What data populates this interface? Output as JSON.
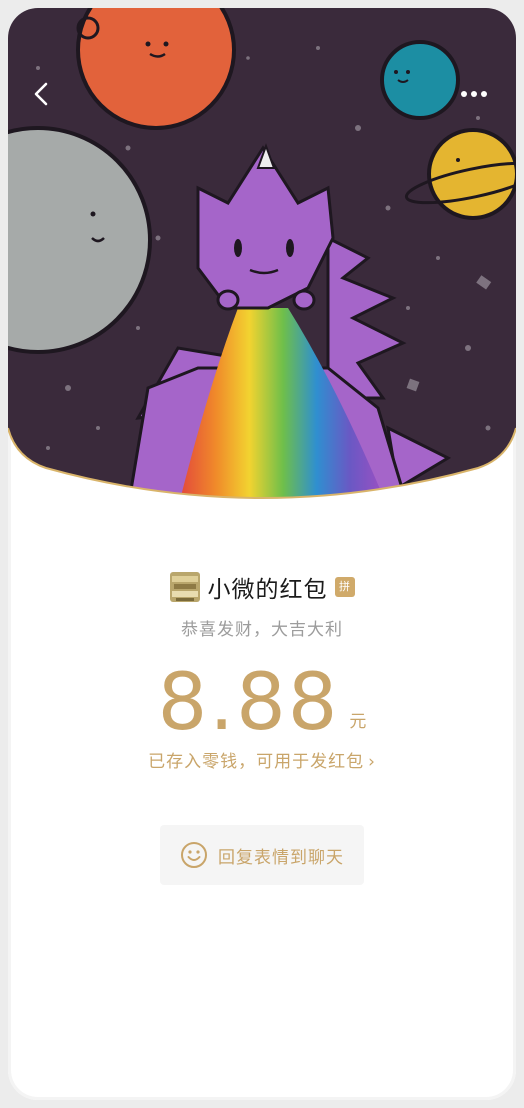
{
  "header": {
    "back_icon": "chevron-left-icon",
    "more_icon": "more-dots-icon"
  },
  "cover": {
    "description_icon": "dragon-space-illustration"
  },
  "envelope": {
    "sender_title": "小微的红包",
    "pin_badge": "拼",
    "wish": "恭喜发财，大吉大利",
    "amount": "8.88",
    "currency_unit": "元",
    "deposit_note": "已存入零钱，可用于发红包",
    "deposit_chevron": "›"
  },
  "reply_button": {
    "label": "回复表情到聊天",
    "icon": "smiley-icon"
  },
  "colors": {
    "accent_gold": "#c9a56a",
    "space_bg": "#3a2a3b",
    "badge_gold": "#d0aa6a"
  }
}
